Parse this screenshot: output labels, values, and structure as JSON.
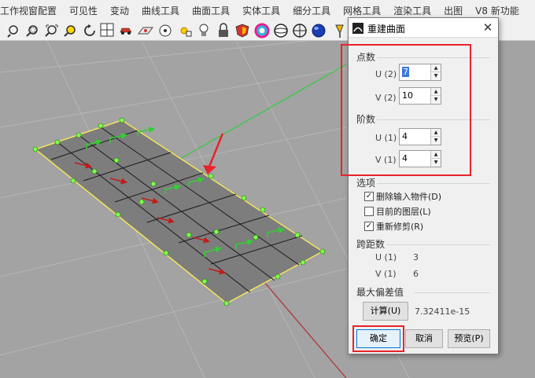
{
  "menubar": {
    "items": [
      "工作视窗配置",
      "可见性",
      "变动",
      "曲线工具",
      "曲面工具",
      "实体工具",
      "细分工具",
      "网格工具",
      "渲染工具",
      "出图",
      "V8 新功能"
    ]
  },
  "toolbar": {
    "icons": [
      "zoom-window-icon",
      "zoom-selected-icon",
      "zoom-extents-icon",
      "zoom-target-icon",
      "undo-view-icon",
      "four-views-icon",
      "car-icon",
      "cplane-icon",
      "display-mode-icon",
      "sun-icon",
      "bulb-icon",
      "lock-icon",
      "shield-icon",
      "color-wheel-icon",
      "sphere-ghost-icon",
      "sphere-shaded-icon",
      "globe-icon",
      "tools-icon"
    ]
  },
  "dialog": {
    "title": "重建曲面",
    "close_symbol": "✕",
    "point_count": {
      "heading": "点数",
      "u_label": "U (2)",
      "u_value": "7",
      "v_label": "V (2)",
      "v_value": "10"
    },
    "degree": {
      "heading": "阶数",
      "u_label": "U (1)",
      "u_value": "4",
      "v_label": "V (1)",
      "v_value": "4"
    },
    "options": {
      "heading": "选项",
      "items": [
        {
          "label": "删除输入物件(D)",
          "checked": true
        },
        {
          "label": "目前的图层(L)",
          "checked": false
        },
        {
          "label": "重新修剪(R)",
          "checked": true
        }
      ]
    },
    "span": {
      "heading": "跨距数",
      "u_label": "U (1)",
      "u_value": "3",
      "v_label": "V (1)",
      "v_value": "6"
    },
    "deviation": {
      "heading": "最大偏差值",
      "calc_label": "计算(U)",
      "value": "7.32411e-15"
    },
    "buttons": {
      "ok": "确定",
      "cancel": "取消",
      "preview": "预览(P)"
    }
  },
  "colors": {
    "highlight_red": "#e8232a",
    "x_axis": "#c0392b",
    "y_axis": "#2ecc40",
    "control_point": "#7dff4d",
    "surface_edge": "#f2e35a"
  }
}
